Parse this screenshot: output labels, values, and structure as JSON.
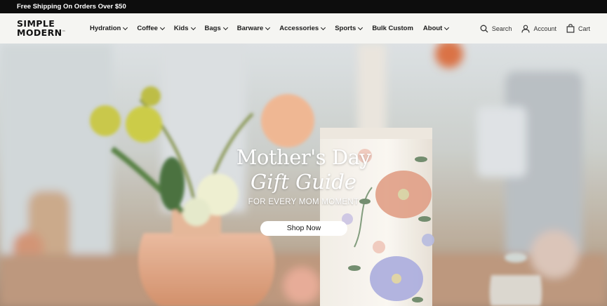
{
  "promo": {
    "text": "Free Shipping On Orders Over $50"
  },
  "brand": {
    "line1": "SIMPLE",
    "line2": "MODERN"
  },
  "nav": {
    "items": [
      {
        "label": "Hydration",
        "has_dropdown": true
      },
      {
        "label": "Coffee",
        "has_dropdown": true
      },
      {
        "label": "Kids",
        "has_dropdown": true
      },
      {
        "label": "Bags",
        "has_dropdown": true
      },
      {
        "label": "Barware",
        "has_dropdown": true
      },
      {
        "label": "Accessories",
        "has_dropdown": true
      },
      {
        "label": "Sports",
        "has_dropdown": true
      },
      {
        "label": "Bulk Custom",
        "has_dropdown": false
      },
      {
        "label": "About",
        "has_dropdown": true
      }
    ],
    "search_label": "Search",
    "account_label": "Account",
    "cart_label": "Cart"
  },
  "hero": {
    "title_line1": "Mother's Day",
    "title_line2": "Gift Guide",
    "subtitle": "FOR EVERY MOM MOMENT",
    "cta_label": "Shop Now"
  },
  "colors": {
    "promo_bg": "#0d0d0d",
    "nav_bg": "#f5f5f2",
    "text": "#1b1b1b"
  }
}
